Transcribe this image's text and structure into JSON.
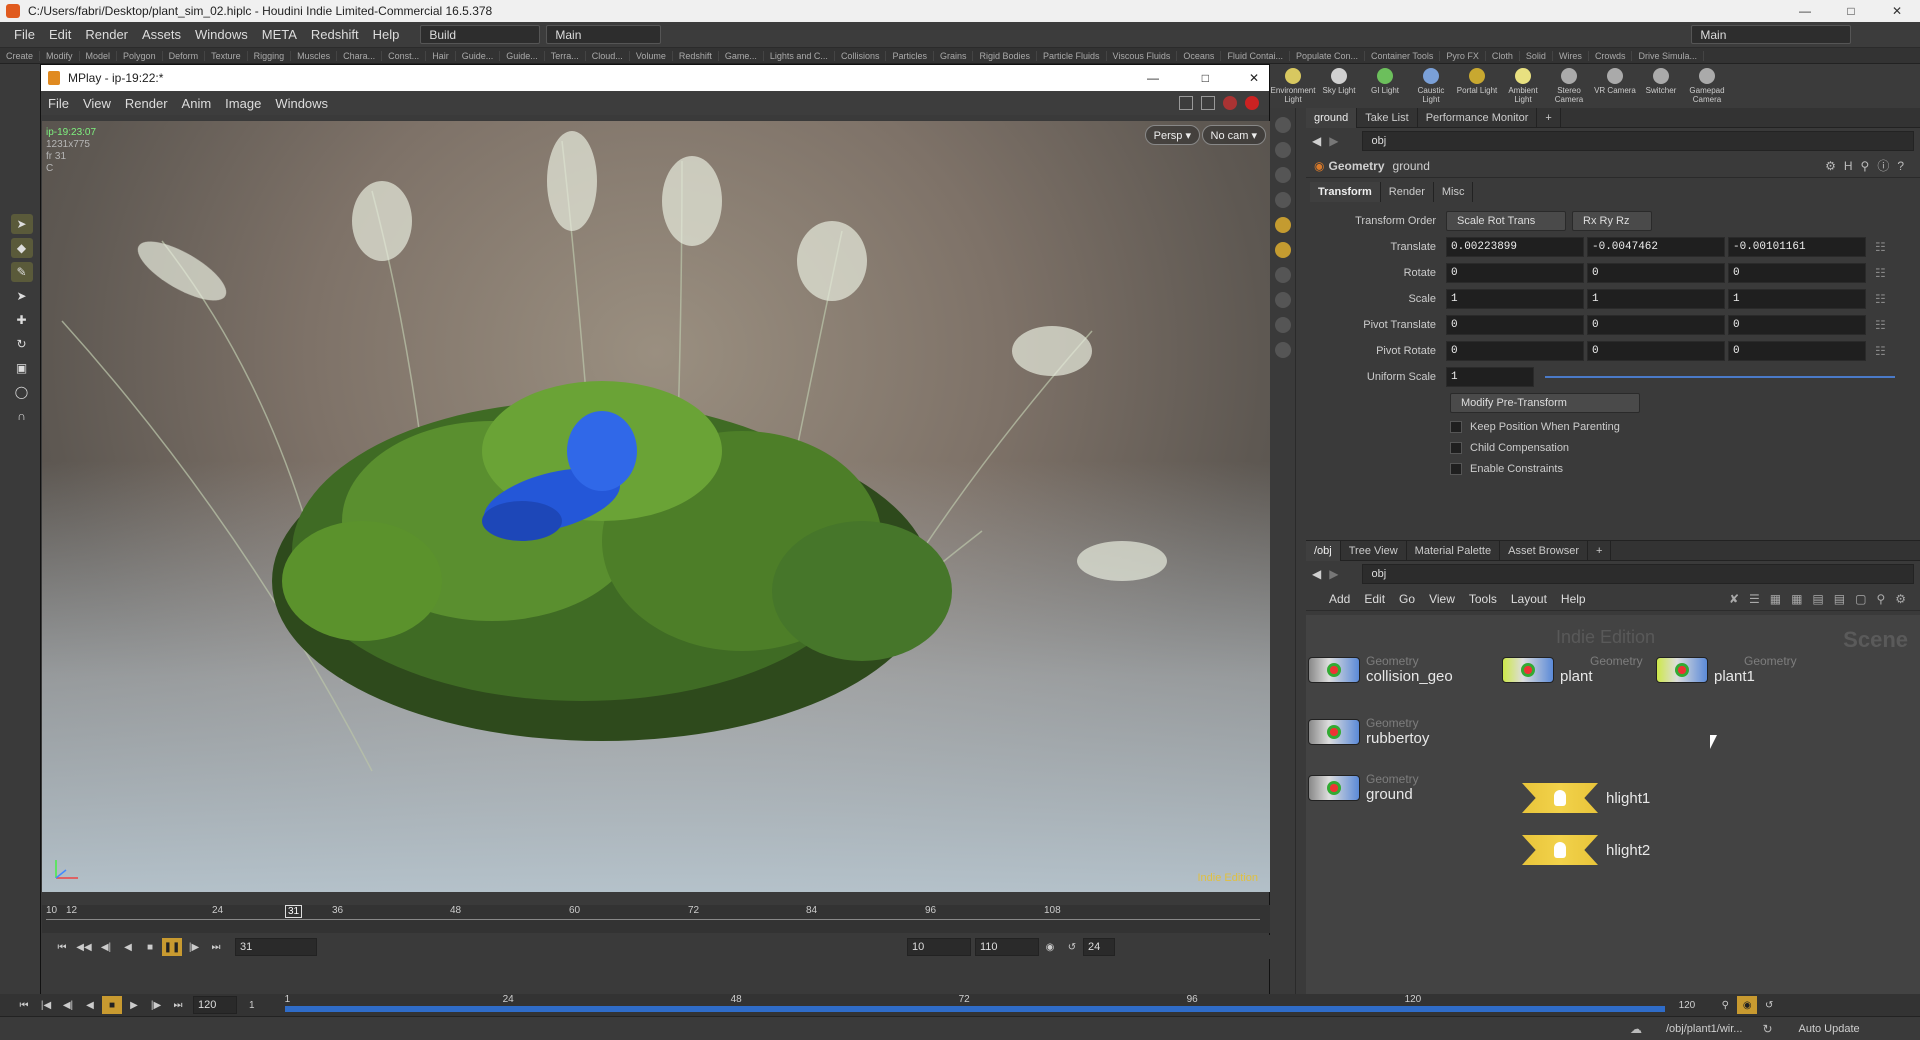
{
  "window": {
    "title": "C:/Users/fabri/Desktop/plant_sim_02.hiplc - Houdini Indie Limited-Commercial 16.5.378"
  },
  "main_menu": [
    "File",
    "Edit",
    "Render",
    "Assets",
    "Windows",
    "META",
    "Redshift",
    "Help"
  ],
  "desktop": {
    "build": "Build",
    "main": "Main",
    "main_right": "Main"
  },
  "shelf_tabs": [
    "Create",
    "Modify",
    "Model",
    "Polygon",
    "Deform",
    "Texture",
    "Rigging",
    "Muscles",
    "Chara...",
    "Const...",
    "Hair",
    "Guide...",
    "Guide...",
    "Terra...",
    "Cloud...",
    "Volume",
    "Redshift",
    "Game...",
    "Lights and C...",
    "Collisions",
    "Particles",
    "Grains",
    "Rigid Bodies",
    "Particle Fluids",
    "Viscous Fluids",
    "Oceans",
    "Fluid Contai...",
    "Populate Con...",
    "Container Tools",
    "Pyro FX",
    "Cloth",
    "Solid",
    "Wires",
    "Crowds",
    "Drive Simula..."
  ],
  "light_tools": [
    {
      "label": "Environment Light",
      "color": "#d8c860"
    },
    {
      "label": "Sky Light",
      "color": "#d0d0d0"
    },
    {
      "label": "GI Light",
      "color": "#6cbf5c"
    },
    {
      "label": "Caustic Light",
      "color": "#7aa0d8"
    },
    {
      "label": "Portal Light",
      "color": "#c8a830"
    },
    {
      "label": "Ambient Light",
      "color": "#e8e080"
    },
    {
      "label": "Stereo Camera",
      "color": "#aaaaaa"
    },
    {
      "label": "VR Camera",
      "color": "#aaaaaa"
    },
    {
      "label": "Switcher",
      "color": "#aaaaaa"
    },
    {
      "label": "Gamepad Camera",
      "color": "#aaaaaa"
    }
  ],
  "mplay": {
    "title": "MPlay - ip-19:22:*",
    "menu": [
      "File",
      "View",
      "Render",
      "Anim",
      "Image",
      "Windows"
    ],
    "info": {
      "name": "ip-19:23:07",
      "res": "1231x775",
      "frame": "fr 31",
      "chan": "C"
    },
    "persp": "Persp ▾",
    "cam": "No cam ▾",
    "watermark": "Indie Edition",
    "ticks": [
      "10",
      "12",
      "24",
      "31",
      "36",
      "48",
      "60",
      "72",
      "84",
      "96",
      "108"
    ],
    "current_frame": "31",
    "range_start": "10",
    "range_end": "110",
    "fps": "24"
  },
  "global_timeline": {
    "start": "120",
    "a": "1",
    "b": "1",
    "ticks": [
      "1",
      "24",
      "48",
      "72",
      "96",
      "120"
    ],
    "end_a": "120",
    "end_b": "120"
  },
  "param_pane": {
    "tabs": [
      "ground",
      "Take List",
      "Performance Monitor"
    ],
    "path": "obj",
    "node_type": "Geometry",
    "node_name": "ground",
    "subtabs": [
      "Transform",
      "Render",
      "Misc"
    ],
    "transform_order": {
      "label": "Transform Order",
      "a": "Scale Rot Trans",
      "b": "Rx Ry Rz"
    },
    "rows": [
      {
        "label": "Translate",
        "v": [
          "0.00223899",
          "-0.0047462",
          "-0.00101161"
        ]
      },
      {
        "label": "Rotate",
        "v": [
          "0",
          "0",
          "0"
        ]
      },
      {
        "label": "Scale",
        "v": [
          "1",
          "1",
          "1"
        ]
      },
      {
        "label": "Pivot Translate",
        "v": [
          "0",
          "0",
          "0"
        ]
      },
      {
        "label": "Pivot Rotate",
        "v": [
          "0",
          "0",
          "0"
        ]
      }
    ],
    "uniform_scale": {
      "label": "Uniform Scale",
      "value": "1"
    },
    "modify_pre": "Modify Pre-Transform",
    "checks": [
      "Keep Position When Parenting",
      "Child Compensation",
      "Enable Constraints"
    ]
  },
  "network_pane": {
    "tabs": [
      "/obj",
      "Tree View",
      "Material Palette",
      "Asset Browser"
    ],
    "path": "obj",
    "menu": [
      "Add",
      "Edit",
      "Go",
      "View",
      "Tools",
      "Layout",
      "Help"
    ],
    "watermark": "Indie Edition",
    "context": "Scene",
    "nodes": [
      {
        "type": "Geometry",
        "name": "collision_geo",
        "flag": false
      },
      {
        "type": "Geometry",
        "name": "plant",
        "flag": true
      },
      {
        "type": "Geometry",
        "name": "plant1",
        "flag": true
      },
      {
        "type": "Geometry",
        "name": "rubbertoy",
        "flag": false
      },
      {
        "type": "Geometry",
        "name": "ground",
        "flag": false
      }
    ],
    "lights": [
      {
        "name": "hlight1"
      },
      {
        "name": "hlight2"
      }
    ]
  },
  "status": {
    "path": "/obj/plant1/wir...",
    "update": "Auto Update"
  }
}
